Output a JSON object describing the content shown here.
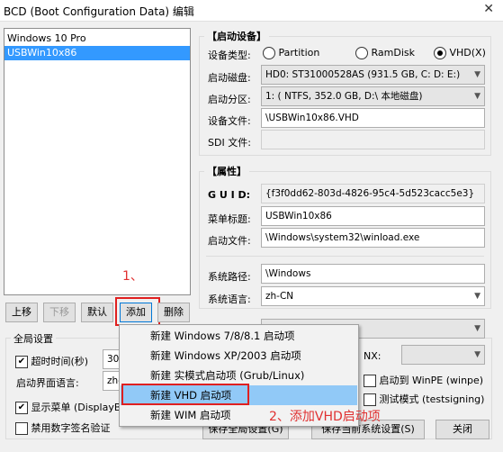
{
  "window": {
    "title": "BCD (Boot Configuration Data) 编辑",
    "close_glyph": "✕"
  },
  "boot_list": {
    "items": [
      {
        "label": "Windows 10 Pro",
        "selected": false
      },
      {
        "label": "USBWin10x86",
        "selected": true
      }
    ]
  },
  "list_buttons": {
    "move_up": "上移",
    "move_down": "下移",
    "default": "默认",
    "add": "添加",
    "delete": "删除"
  },
  "annotations": {
    "step1": "1、",
    "step2": "2、添加VHD启动项",
    "highlight_color": "#e02020"
  },
  "boot_device": {
    "group_label": "【启动设备】",
    "device_type_label": "设备类型:",
    "device_types": [
      {
        "label": "Partition",
        "selected": false
      },
      {
        "label": "RamDisk",
        "selected": false
      },
      {
        "label": "VHD(X)",
        "selected": true
      }
    ],
    "boot_disk_label": "启动磁盘:",
    "boot_disk_value": "HD0: ST31000528AS (931.5 GB, C: D: E:)",
    "boot_partition_label": "启动分区:",
    "boot_partition_value": "1: ( NTFS, 352.0 GB, D:\\ 本地磁盘)",
    "device_file_label": "设备文件:",
    "device_file_value": "\\USBWin10x86.VHD",
    "sdi_file_label": "SDI 文件:",
    "sdi_file_value": ""
  },
  "properties": {
    "group_label": "【属性】",
    "guid_label": "G U I D:",
    "guid_value": "{f3f0dd62-803d-4826-95c4-5d523cacc5e3}",
    "menu_title_label": "菜单标题:",
    "menu_title_value": "USBWin10x86",
    "boot_file_label": "启动文件:",
    "boot_file_value": "\\Windows\\system32\\winload.exe",
    "system_path_label": "系统路径:",
    "system_path_value": "\\Windows",
    "system_lang_label": "系统语言:",
    "system_lang_value": "zh-CN"
  },
  "global": {
    "group_label": "全局设置",
    "timeout_label": "超时时间(秒)",
    "timeout_checked": true,
    "timeout_value": "30",
    "ui_lang_label": "启动界面语言:",
    "ui_lang_value": "zh-",
    "show_menu_label": "显示菜单 (DisplayBo",
    "show_menu_checked": true,
    "disable_sig_label": "禁用数字签名验证",
    "disable_sig_checked": false,
    "nx_label": "NX:",
    "winpe_label": "启动到 WinPE (winpe)",
    "winpe_checked": false,
    "testsign_label": "测试模式 (testsigning)",
    "testsign_checked": false
  },
  "bottom_buttons": {
    "save_global": "保存全局设置(G)",
    "save_current": "保存当前系统设置(S)",
    "close": "关闭"
  },
  "add_menu": {
    "items": [
      {
        "label": "新建 Windows 7/8/8.1 启动项",
        "highlighted": false
      },
      {
        "label": "新建 Windows XP/2003 启动项",
        "highlighted": false
      },
      {
        "label": "新建 实模式启动项 (Grub/Linux)",
        "highlighted": false
      },
      {
        "label": "新建 VHD 启动项",
        "highlighted": true
      },
      {
        "label": "新建 WIM 启动项",
        "highlighted": false
      }
    ]
  }
}
